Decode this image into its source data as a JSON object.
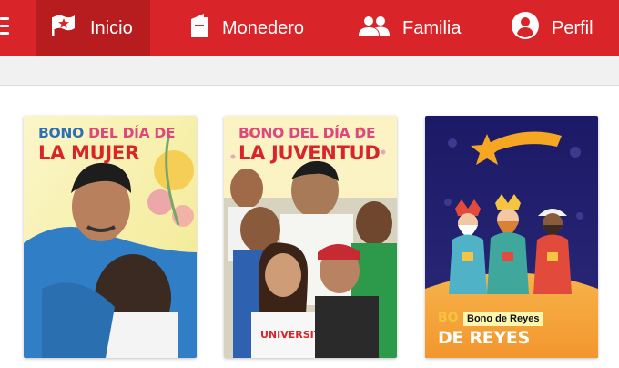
{
  "nav": {
    "items": [
      {
        "label": "Inicio",
        "icon": "star-flag-icon",
        "active": true
      },
      {
        "label": "Monedero",
        "icon": "wallet-icon",
        "active": false
      },
      {
        "label": "Familia",
        "icon": "family-icon",
        "active": false
      },
      {
        "label": "Perfil",
        "icon": "profile-icon",
        "active": false
      }
    ]
  },
  "cards": [
    {
      "line1_a": "BONO",
      "line1_b": "DEL DÍA DE",
      "line2": "LA MUJER"
    },
    {
      "line1_a": "BONO",
      "line1_b": "DEL DÍA DE",
      "line2": "LA JUVENTUD"
    },
    {
      "line1_a": "BO",
      "line2": "DE REYES",
      "tag": "Bono de Reyes"
    }
  ],
  "colors": {
    "primary": "#d9242a",
    "primary_dark": "#b71c1f",
    "accent_blue": "#2b6fb6",
    "accent_pink": "#e0457b"
  }
}
